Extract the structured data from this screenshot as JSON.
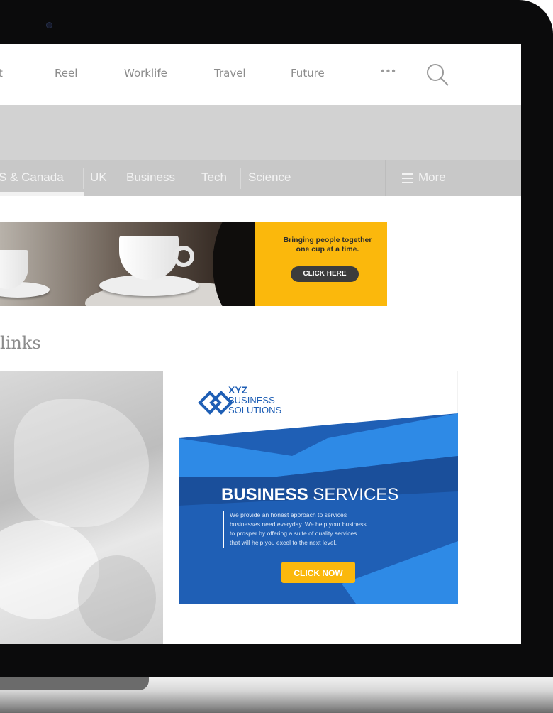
{
  "top_nav": {
    "items": [
      "t",
      "Reel",
      "Worklife",
      "Travel",
      "Future"
    ],
    "more_label": "•••"
  },
  "sub_nav": {
    "items": [
      "S & Canada",
      "UK",
      "Business",
      "Tech",
      "Science"
    ],
    "more_label": "More"
  },
  "banner_ad": {
    "tagline_line1": "Bringing people together",
    "tagline_line2": "one cup at a time.",
    "cta": "CLICK HERE",
    "accent": "#fbb80c"
  },
  "section": {
    "heading": "links"
  },
  "side_ad": {
    "logo_line1": "XYZ",
    "logo_line2": "BUSINESS",
    "logo_line3": "SOLUTIONS",
    "headline_bold": "BUSINESS",
    "headline_light": " SERVICES",
    "body_lines": [
      "We provide an honest approach to services",
      "businesses need everyday. We help your business",
      "to prosper by offering a suite of quality services",
      "that will help you excel to the next level."
    ],
    "cta": "CLICK NOW",
    "primary_color": "#1f5fb5",
    "cta_color": "#fbb80c"
  }
}
